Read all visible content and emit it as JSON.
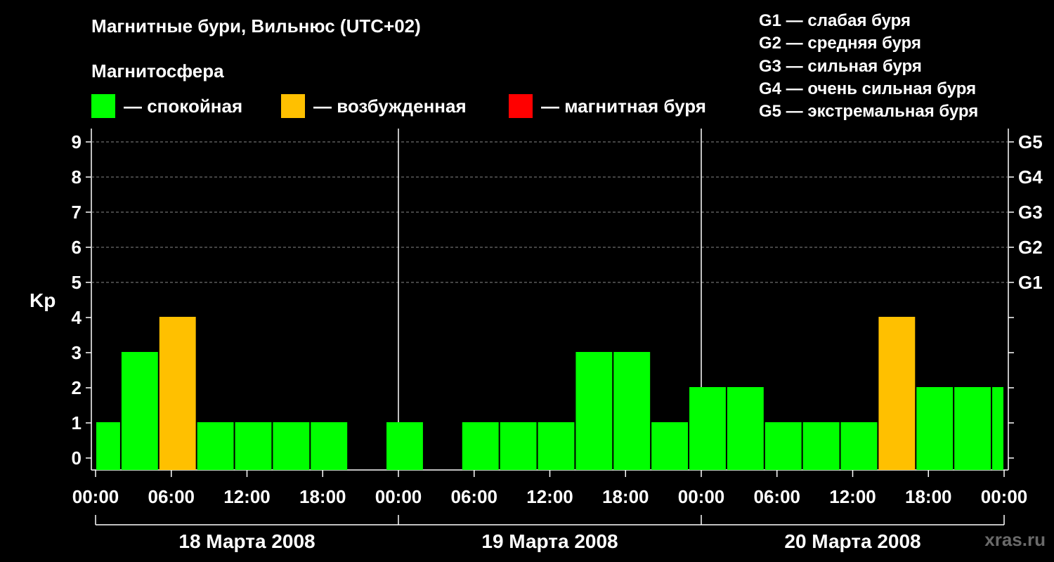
{
  "header": {
    "title": "Магнитные бури, Вильнюс (UTC+02)",
    "subtitle": "Магнитосфера"
  },
  "legend": [
    {
      "label": "— спокойная",
      "color": "#00ff00"
    },
    {
      "label": "— возбужденная",
      "color": "#ffc000"
    },
    {
      "label": "— магнитная буря",
      "color": "#ff0000"
    }
  ],
  "storm_scale": [
    "G1 — слабая буря",
    "G2 — средняя буря",
    "G3 — сильная буря",
    "G4 — очень сильная буря",
    "G5 — экстремальная буря"
  ],
  "watermark": "xras.ru",
  "chart_data": {
    "type": "bar",
    "ylabel": "Kp",
    "ylim": [
      0,
      9
    ],
    "yticks": [
      0,
      1,
      2,
      3,
      4,
      5,
      6,
      7,
      8,
      9
    ],
    "right_axis_labels": [
      {
        "kp": 5,
        "label": "G1"
      },
      {
        "kp": 6,
        "label": "G2"
      },
      {
        "kp": 7,
        "label": "G3"
      },
      {
        "kp": 8,
        "label": "G4"
      },
      {
        "kp": 9,
        "label": "G5"
      }
    ],
    "xtick_labels": [
      "00:00",
      "06:00",
      "12:00",
      "18:00",
      "00:00",
      "06:00",
      "12:00",
      "18:00",
      "00:00",
      "06:00",
      "12:00",
      "18:00",
      "00:00"
    ],
    "days": [
      "18 Марта 2008",
      "19 Марта 2008",
      "20 Марта 2008"
    ],
    "bars": [
      {
        "start": "18 Марта 2008 00:00",
        "end": "18 Марта 2008 02:00",
        "kp": 1,
        "color": "#00ff00"
      },
      {
        "start": "18 Марта 2008 02:00",
        "end": "18 Марта 2008 05:00",
        "kp": 3,
        "color": "#00ff00"
      },
      {
        "start": "18 Марта 2008 05:00",
        "end": "18 Марта 2008 08:00",
        "kp": 4,
        "color": "#ffc000"
      },
      {
        "start": "18 Марта 2008 08:00",
        "end": "18 Марта 2008 11:00",
        "kp": 1,
        "color": "#00ff00"
      },
      {
        "start": "18 Марта 2008 11:00",
        "end": "18 Марта 2008 14:00",
        "kp": 1,
        "color": "#00ff00"
      },
      {
        "start": "18 Марта 2008 14:00",
        "end": "18 Марта 2008 17:00",
        "kp": 1,
        "color": "#00ff00"
      },
      {
        "start": "18 Марта 2008 17:00",
        "end": "18 Марта 2008 20:00",
        "kp": 1,
        "color": "#00ff00"
      },
      {
        "start": "18 Марта 2008 23:00",
        "end": "19 Марта 2008 02:00",
        "kp": 1,
        "color": "#00ff00"
      },
      {
        "start": "19 Марта 2008 05:00",
        "end": "19 Марта 2008 08:00",
        "kp": 1,
        "color": "#00ff00"
      },
      {
        "start": "19 Марта 2008 08:00",
        "end": "19 Марта 2008 11:00",
        "kp": 1,
        "color": "#00ff00"
      },
      {
        "start": "19 Марта 2008 11:00",
        "end": "19 Марта 2008 14:00",
        "kp": 1,
        "color": "#00ff00"
      },
      {
        "start": "19 Марта 2008 14:00",
        "end": "19 Марта 2008 17:00",
        "kp": 3,
        "color": "#00ff00"
      },
      {
        "start": "19 Марта 2008 17:00",
        "end": "19 Марта 2008 20:00",
        "kp": 3,
        "color": "#00ff00"
      },
      {
        "start": "19 Марта 2008 20:00",
        "end": "19 Марта 2008 23:00",
        "kp": 1,
        "color": "#00ff00"
      },
      {
        "start": "19 Марта 2008 23:00",
        "end": "20 Марта 2008 02:00",
        "kp": 2,
        "color": "#00ff00"
      },
      {
        "start": "20 Марта 2008 02:00",
        "end": "20 Марта 2008 05:00",
        "kp": 2,
        "color": "#00ff00"
      },
      {
        "start": "20 Марта 2008 05:00",
        "end": "20 Марта 2008 08:00",
        "kp": 1,
        "color": "#00ff00"
      },
      {
        "start": "20 Марта 2008 08:00",
        "end": "20 Марта 2008 11:00",
        "kp": 1,
        "color": "#00ff00"
      },
      {
        "start": "20 Марта 2008 11:00",
        "end": "20 Марта 2008 14:00",
        "kp": 1,
        "color": "#00ff00"
      },
      {
        "start": "20 Марта 2008 14:00",
        "end": "20 Марта 2008 17:00",
        "kp": 4,
        "color": "#ffc000"
      },
      {
        "start": "20 Марта 2008 17:00",
        "end": "20 Марта 2008 20:00",
        "kp": 2,
        "color": "#00ff00"
      },
      {
        "start": "20 Марта 2008 20:00",
        "end": "20 Марта 2008 23:00",
        "kp": 2,
        "color": "#00ff00"
      },
      {
        "start": "20 Марта 2008 23:00",
        "end": "21 Марта 2008 00:00",
        "kp": 2,
        "color": "#00ff00"
      }
    ]
  }
}
